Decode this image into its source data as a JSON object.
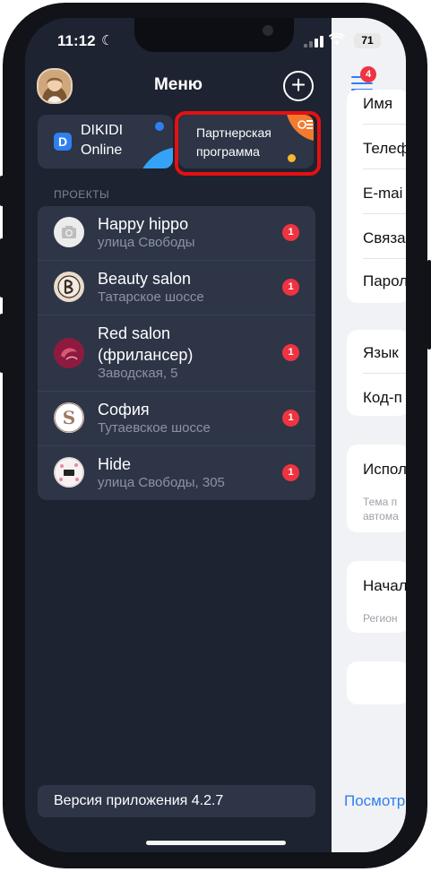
{
  "status_bar": {
    "time": "11:12",
    "battery": "71"
  },
  "header": {
    "title": "Меню"
  },
  "tiles": {
    "dikidi": {
      "logo_letter": "D",
      "line1": "DIKIDI",
      "line2": "Online"
    },
    "partner": {
      "line1": "Партнерская",
      "line2": "программа"
    }
  },
  "projects": {
    "section_label": "ПРОЕКТЫ",
    "items": [
      {
        "name": "Happy hippo",
        "address": "улица Свободы",
        "badge": "1"
      },
      {
        "name": "Beauty salon",
        "address": "Татарское шоссе",
        "badge": "1"
      },
      {
        "name_line1": "Red salon",
        "name_line2": "(фрилансер)",
        "address": "Заводская, 5",
        "badge": "1"
      },
      {
        "name": "София",
        "address": "Тутаевское шоссе",
        "badge": "1"
      },
      {
        "name": "Hide",
        "address": "улица Свободы, 305",
        "badge": "1"
      }
    ]
  },
  "version": "Версия приложения 4.2.7",
  "background_app": {
    "nav_badge": "4",
    "rows": [
      "Имя",
      "Телеф",
      "E-mai",
      "Связа",
      "Парол",
      "Язык",
      "Код-п",
      "Испол",
      "Начал"
    ],
    "subtexts": [
      "Тема п",
      "автома",
      "Регион"
    ],
    "link": "Посмотр"
  },
  "colors": {
    "accent": "#2f7ff0",
    "badge": "#ef3340",
    "highlight": "#e51013",
    "panel": "#1d2330",
    "card": "#2d3547"
  }
}
